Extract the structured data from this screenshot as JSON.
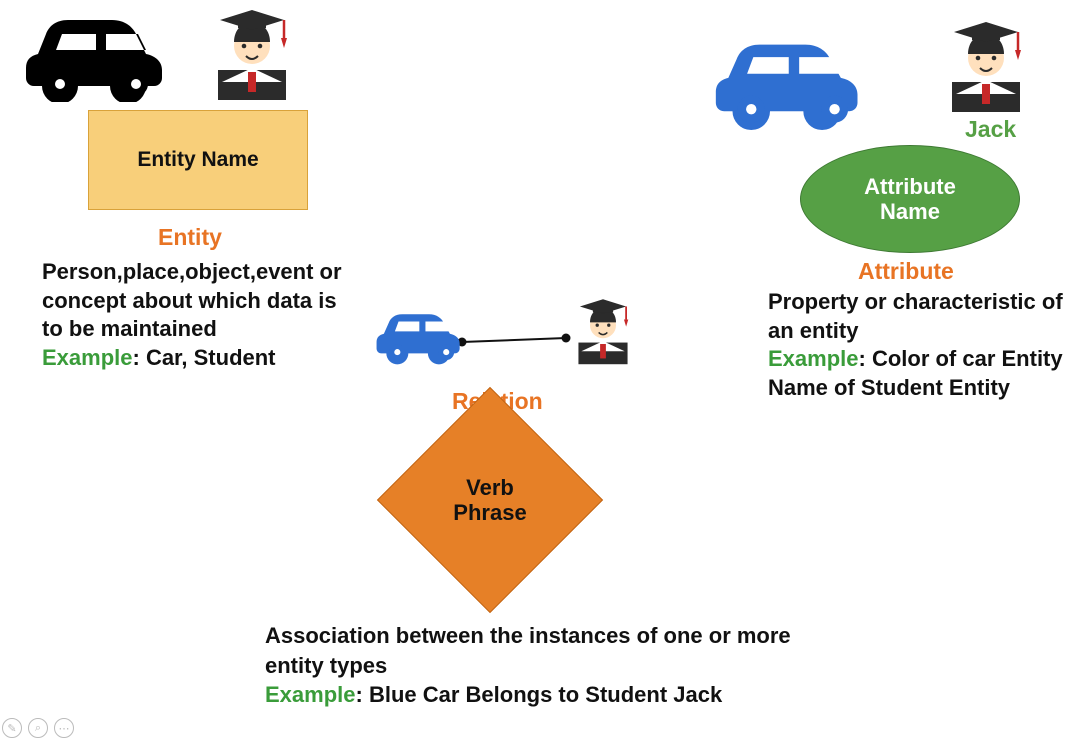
{
  "entity": {
    "box_label": "Entity Name",
    "title": "Entity",
    "desc": "Person,place,object,event or concept about which data is to be maintained",
    "example_label": "Example",
    "example_text": ": Car, Student"
  },
  "attribute": {
    "ellipse_label": "Attribute Name",
    "jack_label": "Jack",
    "title": "Attribute",
    "desc": "Property or characteristic of an entity",
    "example_label": "Example",
    "example_text": ": Color of car Entity Name of Student Entity"
  },
  "relation": {
    "title": "Relation",
    "diamond_label": "Verb Phrase",
    "desc": "Association between the instances of one or more entity types",
    "example_label": "Example",
    "example_text": ": Blue Car Belongs to Student Jack"
  },
  "icons": {
    "car_black": "car-icon",
    "car_blue": "car-icon",
    "student": "student-icon"
  },
  "colors": {
    "accent_orange": "#e87424",
    "entity_fill": "#f8cf7a",
    "attribute_fill": "#56a045",
    "relation_fill": "#e68027",
    "car_blue": "#2f6fd1"
  }
}
